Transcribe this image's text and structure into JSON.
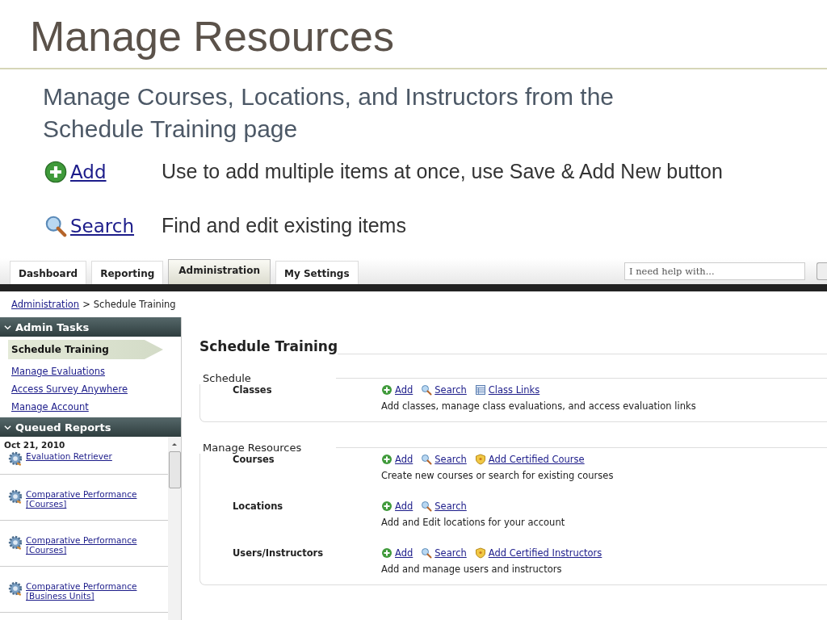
{
  "slide": {
    "title": "Manage Resources",
    "subtitle": "Manage Courses, Locations, and Instructors from the Schedule Training page",
    "features": [
      {
        "kind": "add",
        "link": "Add",
        "description": "Use to add multiple items at once, use Save & Add New button"
      },
      {
        "kind": "search",
        "link": "Search",
        "description": "Find and edit existing items"
      }
    ]
  },
  "app": {
    "tabs": [
      {
        "label": "Dashboard",
        "selected": false
      },
      {
        "label": "Reporting",
        "selected": false
      },
      {
        "label": "Administration",
        "selected": true
      },
      {
        "label": "My Settings",
        "selected": false
      }
    ],
    "help_search": {
      "placeholder": "I need help with..."
    },
    "breadcrumb": {
      "link": "Administration",
      "separator": ">",
      "current": "Schedule Training"
    },
    "sidebar": {
      "admin_tasks": {
        "title": "Admin Tasks",
        "items": [
          {
            "label": "Schedule Training",
            "selected": true
          },
          {
            "label": "Manage Evaluations",
            "selected": false
          },
          {
            "label": "Access Survey Anywhere",
            "selected": false
          },
          {
            "label": "Manage Account",
            "selected": false
          }
        ]
      },
      "queued_reports": {
        "title": "Queued Reports",
        "date": "Oct 21, 2010",
        "reports": [
          {
            "title": "Evaluation Retriever"
          },
          {
            "title": "Comparative Performance [Courses]"
          },
          {
            "title": "Comparative Performance [Courses]"
          },
          {
            "title": "Comparative Performance [Business Units]"
          }
        ]
      }
    },
    "content": {
      "heading": "Schedule Training",
      "groups": [
        {
          "title": "Schedule",
          "rows": [
            {
              "label": "Classes",
              "actions": [
                {
                  "kind": "add",
                  "label": "Add"
                },
                {
                  "kind": "search",
                  "label": "Search"
                },
                {
                  "kind": "class-links",
                  "label": "Class Links"
                }
              ],
              "description": "Add classes, manage class evaluations, and access evaluation links"
            }
          ]
        },
        {
          "title": "Manage Resources",
          "rows": [
            {
              "label": "Courses",
              "actions": [
                {
                  "kind": "add",
                  "label": "Add"
                },
                {
                  "kind": "search",
                  "label": "Search"
                },
                {
                  "kind": "certified",
                  "label": "Add Certified Course"
                }
              ],
              "description": "Create new courses or search for existing courses"
            },
            {
              "label": "Locations",
              "actions": [
                {
                  "kind": "add",
                  "label": "Add"
                },
                {
                  "kind": "search",
                  "label": "Search"
                }
              ],
              "description": "Add and Edit locations for your account"
            },
            {
              "label": "Users/Instructors",
              "actions": [
                {
                  "kind": "add",
                  "label": "Add"
                },
                {
                  "kind": "search",
                  "label": "Search"
                },
                {
                  "kind": "certified",
                  "label": "Add Certified Instructors"
                }
              ],
              "description": "Add and manage users and instructors"
            }
          ]
        }
      ]
    }
  }
}
